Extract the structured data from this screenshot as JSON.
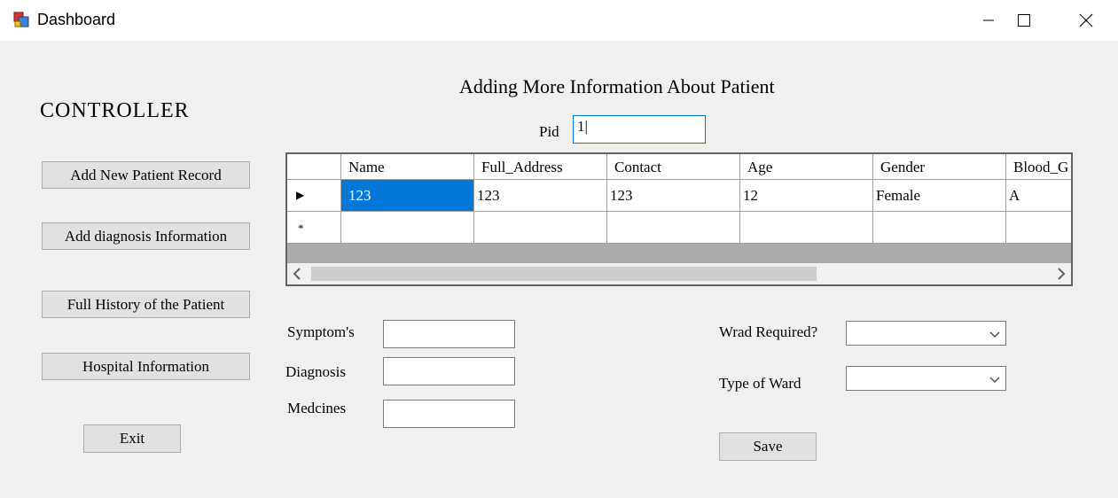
{
  "window": {
    "title": "Dashboard"
  },
  "sidebar": {
    "heading": "CONTROLLER",
    "buttons": [
      "Add New Patient Record",
      "Add diagnosis Information",
      "Full History of the Patient",
      "Hospital Information"
    ],
    "exit_label": "Exit"
  },
  "main": {
    "title": "Adding More Information About Patient",
    "pid_label": "Pid",
    "pid_value": "1|"
  },
  "grid": {
    "columns": [
      "Name",
      "Full_Address",
      "Contact",
      "Age",
      "Gender",
      "Blood_G"
    ],
    "rows": [
      [
        "123",
        "123",
        "123",
        "12",
        "Female",
        "A"
      ]
    ],
    "new_row_marker": "*",
    "current_row_marker": "▶"
  },
  "form": {
    "symptoms_label": "Symptom's",
    "diagnosis_label": "Diagnosis",
    "medicines_label": "Medcines",
    "symptoms_value": "",
    "diagnosis_value": "",
    "medicines_value": "",
    "ward_required_label": "Wrad Required?",
    "ward_required_value": "",
    "type_of_ward_label": "Type of Ward",
    "type_of_ward_value": "",
    "save_label": "Save"
  },
  "colors": {
    "selection": "#0078d7",
    "window_bg": "#f0f0f0",
    "grid_bg": "#ababab"
  }
}
